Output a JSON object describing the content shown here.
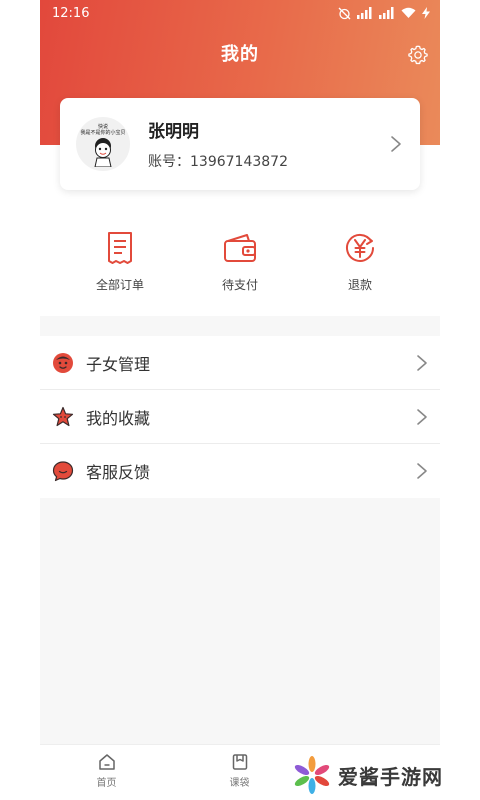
{
  "status_bar": {
    "time": "12:16"
  },
  "header": {
    "title": "我的"
  },
  "profile": {
    "name": "张明明",
    "account": "账号：13967143872",
    "avatar_caption_line1": "快说",
    "avatar_caption_line2": "我是不是你的小宝贝"
  },
  "orders": [
    {
      "label": "全部订单",
      "icon": "receipt-icon"
    },
    {
      "label": "待支付",
      "icon": "wallet-icon"
    },
    {
      "label": "退款",
      "icon": "refund-icon"
    }
  ],
  "menu": [
    {
      "label": "子女管理",
      "icon": "child-face-icon"
    },
    {
      "label": "我的收藏",
      "icon": "star-icon"
    },
    {
      "label": "客服反馈",
      "icon": "chat-bubble-icon"
    }
  ],
  "bottom_nav": [
    {
      "label": "首页",
      "icon": "home-icon"
    },
    {
      "label": "课袋",
      "icon": "bag-icon"
    },
    {
      "label": "",
      "icon": ""
    }
  ],
  "watermark": {
    "text": "爱酱手游网"
  },
  "colors": {
    "accent": "#e24a3b",
    "header_gradient_end": "#ea8a5a",
    "background_gray": "#f7f7f7"
  }
}
